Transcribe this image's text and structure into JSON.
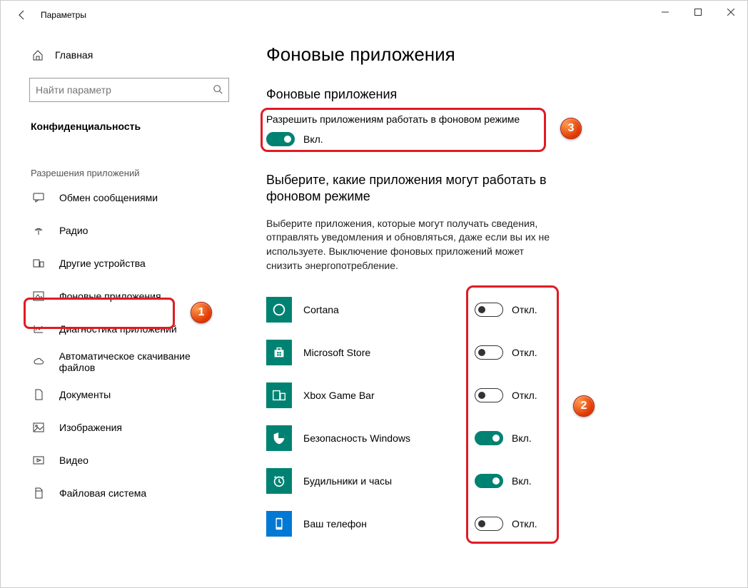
{
  "window": {
    "title": "Параметры"
  },
  "sidebar": {
    "home": "Главная",
    "search_placeholder": "Найти параметр",
    "category": "Конфиденциальность",
    "section_label": "Разрешения приложений",
    "items": [
      {
        "icon": "chat",
        "label": "Обмен сообщениями"
      },
      {
        "icon": "radio",
        "label": "Радио"
      },
      {
        "icon": "devices",
        "label": "Другие устройства"
      },
      {
        "icon": "bg",
        "label": "Фоновые приложения"
      },
      {
        "icon": "diag",
        "label": "Диагностика приложений"
      },
      {
        "icon": "cloud",
        "label": "Автоматическое скачивание файлов"
      },
      {
        "icon": "doc",
        "label": "Документы"
      },
      {
        "icon": "img",
        "label": "Изображения"
      },
      {
        "icon": "video",
        "label": "Видео"
      },
      {
        "icon": "fs",
        "label": "Файловая система"
      }
    ]
  },
  "page": {
    "title": "Фоновые приложения",
    "master_heading": "Фоновые приложения",
    "master_label": "Разрешить приложениям работать в фоновом режиме",
    "master_state": "Вкл.",
    "apps_heading": "Выберите, какие приложения могут работать в фоновом режиме",
    "help_text": "Выберите приложения, которые могут получать сведения, отправлять уведомления и обновляться, даже если вы их не используете. Выключение фоновых приложений может снизить энергопотребление.",
    "on_label": "Вкл.",
    "off_label": "Откл.",
    "apps": [
      {
        "name": "Cortana",
        "state": "off",
        "icon_bg": "#008272",
        "icon": "cortana"
      },
      {
        "name": "Microsoft Store",
        "state": "off",
        "icon_bg": "#008272",
        "icon": "store"
      },
      {
        "name": "Xbox Game Bar",
        "state": "off",
        "icon_bg": "#008272",
        "icon": "xbox"
      },
      {
        "name": "Безопасность Windows",
        "state": "on",
        "icon_bg": "#008272",
        "icon": "shield"
      },
      {
        "name": "Будильники и часы",
        "state": "on",
        "icon_bg": "#008272",
        "icon": "clock"
      },
      {
        "name": "Ваш телефон",
        "state": "off",
        "icon_bg": "#0078d4",
        "icon": "phone"
      }
    ]
  },
  "badges": {
    "1": "1",
    "2": "2",
    "3": "3"
  }
}
